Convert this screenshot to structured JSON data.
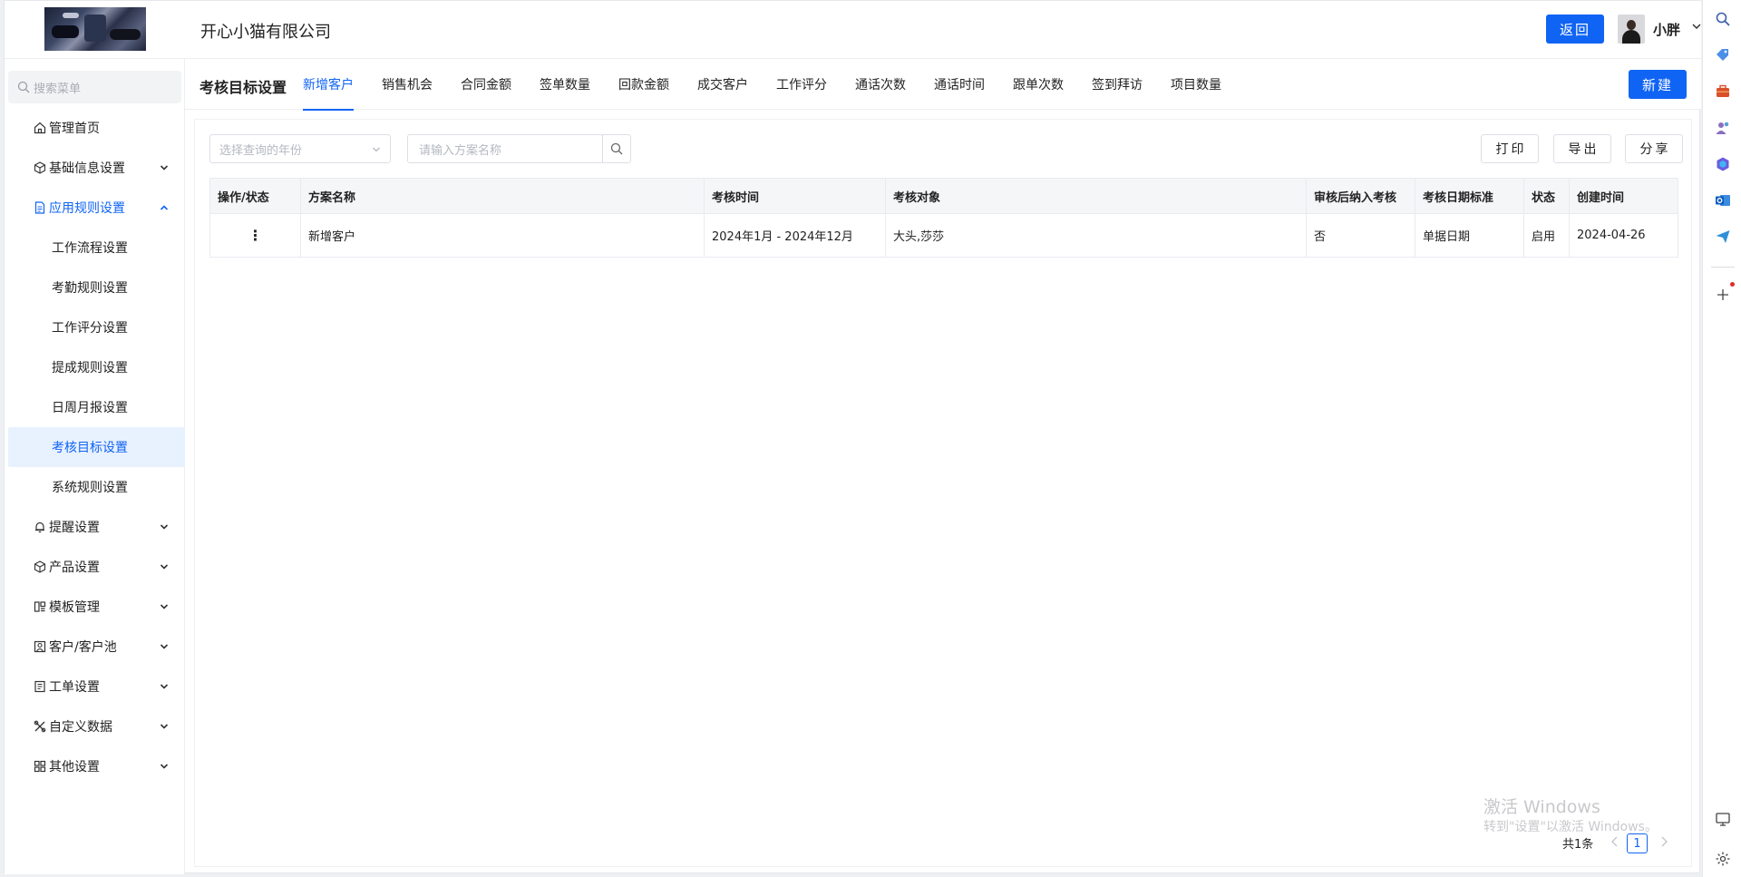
{
  "header": {
    "company": "开心小猫有限公司",
    "back_label": "返回",
    "username": "小胖"
  },
  "sidebar": {
    "search_placeholder": "搜索菜单",
    "items": [
      {
        "label": "管理首页",
        "icon": "home-icon"
      },
      {
        "label": "基础信息设置",
        "icon": "cube-icon"
      },
      {
        "label": "应用规则设置",
        "icon": "document-icon",
        "expanded": true
      },
      {
        "label": "提醒设置",
        "icon": "bell-icon"
      },
      {
        "label": "产品设置",
        "icon": "cube-icon"
      },
      {
        "label": "模板管理",
        "icon": "layout-icon"
      },
      {
        "label": "客户/客户池",
        "icon": "contact-icon"
      },
      {
        "label": "工单设置",
        "icon": "ticket-icon"
      },
      {
        "label": "自定义数据",
        "icon": "tools-icon"
      },
      {
        "label": "其他设置",
        "icon": "grid-icon"
      }
    ],
    "sub_items": [
      "工作流程设置",
      "考勤规则设置",
      "工作评分设置",
      "提成规则设置",
      "日周月报设置",
      "考核目标设置",
      "系统规则设置"
    ],
    "active_sub": "考核目标设置"
  },
  "content": {
    "title": "考核目标设置",
    "tabs": [
      "新增客户",
      "销售机会",
      "合同金额",
      "签单数量",
      "回款金额",
      "成交客户",
      "工作评分",
      "通话次数",
      "通话时间",
      "跟单次数",
      "签到拜访",
      "项目数量"
    ],
    "active_tab": "新增客户",
    "new_label": "新建"
  },
  "filters": {
    "year_placeholder": "选择查询的年份",
    "name_placeholder": "请输入方案名称"
  },
  "toolbar": {
    "print": "打印",
    "export": "导出",
    "share": "分享"
  },
  "table": {
    "columns": [
      "操作/状态",
      "方案名称",
      "考核时间",
      "考核对象",
      "审核后纳入考核",
      "考核日期标准",
      "状态",
      "创建时间"
    ],
    "rows": [
      {
        "op": "⋮",
        "name": "新增客户",
        "period": "2024年1月 - 2024年12月",
        "target": "大头,莎莎",
        "after_review": "否",
        "date_basis": "单据日期",
        "status": "启用",
        "created": "2024-04-26"
      }
    ]
  },
  "pagination": {
    "total": "共1条",
    "current": "1"
  },
  "watermark": {
    "line1": "激活 Windows",
    "line2": "转到\"设置\"以激活 Windows。"
  },
  "colors": {
    "accent": "#1064f4",
    "active_bg": "#e8f1fe"
  }
}
